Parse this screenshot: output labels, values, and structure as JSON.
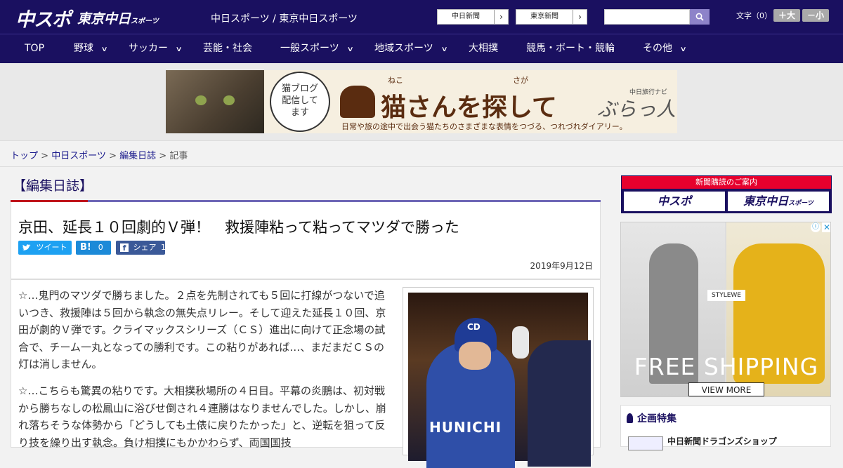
{
  "header": {
    "logo_main": "中スポ",
    "logo_sub": "東京中日",
    "logo_sub_small": "スポーツ",
    "site_title": "中日スポーツ / 東京中日スポーツ",
    "links": [
      {
        "label": "中日新聞",
        "arrow": "›"
      },
      {
        "label": "東京新聞",
        "arrow": "›"
      }
    ],
    "search": {
      "placeholder": "",
      "button_icon": "search-icon"
    },
    "font_size": {
      "label": "文字（0）",
      "bigger": "＋大",
      "smaller": "－小"
    }
  },
  "nav": {
    "items": [
      {
        "label": "TOP",
        "has_dropdown": false
      },
      {
        "label": "野球",
        "has_dropdown": true
      },
      {
        "label": "サッカー",
        "has_dropdown": true
      },
      {
        "label": "芸能・社会",
        "has_dropdown": false
      },
      {
        "label": "一般スポーツ",
        "has_dropdown": true
      },
      {
        "label": "地域スポーツ",
        "has_dropdown": true
      },
      {
        "label": "大相撲",
        "has_dropdown": false
      },
      {
        "label": "競馬・ボート・競輪",
        "has_dropdown": false
      },
      {
        "label": "その他",
        "has_dropdown": true
      }
    ],
    "chevron": "∨"
  },
  "banner": {
    "bubble_text": [
      "猫ブログ",
      "配信して",
      "ます"
    ],
    "title": "猫さんを探して",
    "ruby_neko": "ねこ",
    "ruby_saga": "さが",
    "subtitle": "日常や旅の途中で出会う猫たちのさまざまな表情をつづる、つれづれダイアリー。",
    "navi_small": "中日旅行ナビ",
    "navi": "ぶらっ人"
  },
  "breadcrumb": {
    "items": [
      "トップ",
      "中日スポーツ",
      "編集日誌"
    ],
    "separator": ">",
    "current": "記事"
  },
  "section": {
    "title": "【編集日誌】"
  },
  "article": {
    "headline": "京田、延長１０回劇的Ｖ弾！　救援陣粘って粘ってマツダで勝った",
    "share": {
      "tweet": "ツイート",
      "hatena": "B!",
      "hatena_count": "0",
      "facebook": "シェア",
      "facebook_count": "1"
    },
    "date": "2019年9月12日",
    "paragraphs": [
      "☆…鬼門のマツダで勝ちました。２点を先制されても５回に打線がつないで追いつき、救援陣は５回から執念の無失点リレー。そして迎えた延長１０回、京田が劇的Ｖ弾です。クライマックスシリーズ（ＣＳ）進出に向けて正念場の試合で、チーム一丸となっての勝利です。この粘りがあれば…、まだまだＣＳの灯は消しません。",
      "☆…こちらも驚異の粘りです。大相撲秋場所の４日目。平幕の炎鵬は、初対戦から勝ちなしの松鳳山に浴びせ倒され４連勝はなりませんでした。しかし、崩れ落ちそうな体勢から「どうしても土俵に戻りたかった」と、逆転を狙って反り技を繰り出す執念。負け相撲にもかかわらず、両国国技"
    ],
    "photo": {
      "jersey_text": "HUNICHI",
      "helmet_logo": "CD"
    }
  },
  "sidebar": {
    "subscribe": {
      "header": "新聞購読のご案内",
      "left": "中スポ",
      "right": "東京中日",
      "right_small": "スポーツ"
    },
    "ad": {
      "info": "ⓘ",
      "close": "✕",
      "brand": "STYLEWE",
      "headline": "FREE SHIPPING",
      "cta": "VIEW MORE"
    },
    "feature": {
      "title": "企画特集",
      "item": "中日新聞ドラゴンズショップ"
    }
  }
}
